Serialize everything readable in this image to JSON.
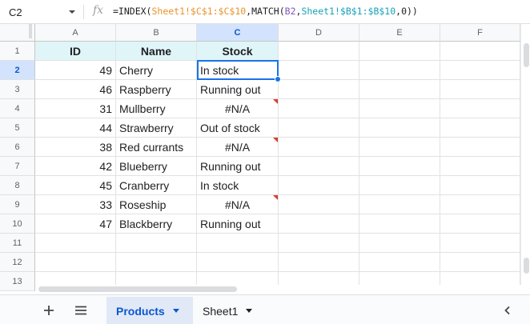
{
  "namebox": {
    "ref": "C2"
  },
  "formula": {
    "icon": "fx-icon",
    "parts": [
      "=INDEX(",
      "Sheet1!$C$1:$C$10",
      ",MATCH(",
      "B2",
      ",",
      "Sheet1!$B$1:$B$10",
      ",0))"
    ]
  },
  "columns": [
    "A",
    "B",
    "C",
    "D",
    "E",
    "F"
  ],
  "rows": [
    "1",
    "2",
    "3",
    "4",
    "5",
    "6",
    "7",
    "8",
    "9",
    "10",
    "11",
    "12",
    "13"
  ],
  "table": {
    "headers": [
      "ID",
      "Name",
      "Stock"
    ],
    "rows": [
      {
        "id": "49",
        "name": "Cherry",
        "stock": "In stock",
        "error": false
      },
      {
        "id": "46",
        "name": "Raspberry",
        "stock": "Running out",
        "error": false
      },
      {
        "id": "31",
        "name": "Mullberry",
        "stock": "#N/A",
        "error": true
      },
      {
        "id": "44",
        "name": "Strawberry",
        "stock": "Out of stock",
        "error": false
      },
      {
        "id": "38",
        "name": "Red currants",
        "stock": "#N/A",
        "error": true
      },
      {
        "id": "42",
        "name": "Blueberry",
        "stock": "Running out",
        "error": false
      },
      {
        "id": "45",
        "name": "Cranberry",
        "stock": "In stock",
        "error": false
      },
      {
        "id": "33",
        "name": "Roseship",
        "stock": "#N/A",
        "error": true
      },
      {
        "id": "47",
        "name": "Blackberry",
        "stock": "Running out",
        "error": false
      }
    ]
  },
  "selected": {
    "column": "C",
    "row": "2"
  },
  "tabs": {
    "add_icon": "plus-icon",
    "menu_icon": "hamburger-icon",
    "items": [
      {
        "label": "Products",
        "active": true
      },
      {
        "label": "Sheet1",
        "active": false
      }
    ],
    "scroll_icon": "chevron-left-icon"
  },
  "colors": {
    "accent": "#1a73e8",
    "header_fill": "#e0f5f8",
    "error_flag": "#db3a2c",
    "ref1": "#e8932b",
    "ref2": "#7e57c2",
    "ref3": "#17a2b8"
  }
}
